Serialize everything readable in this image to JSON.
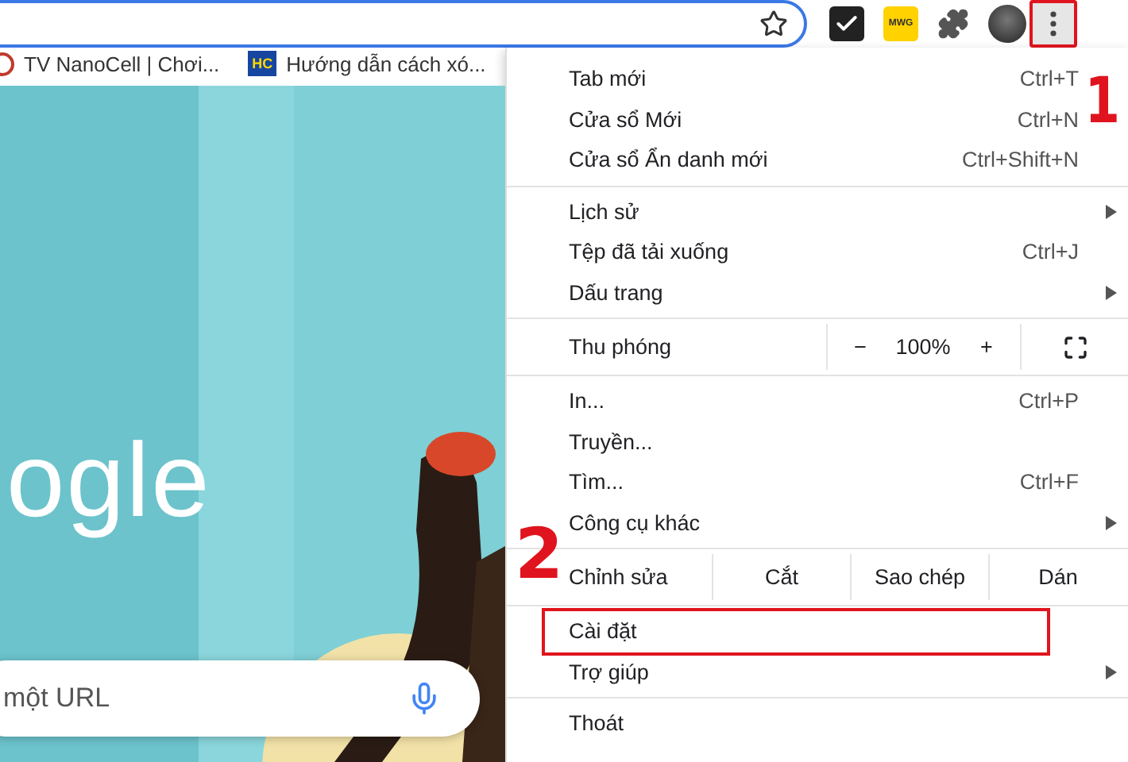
{
  "toolbar": {
    "extensions": [
      {
        "kind": "check"
      },
      {
        "kind": "badge",
        "label": "MWG"
      },
      {
        "kind": "puzzle"
      },
      {
        "kind": "avatar"
      }
    ],
    "menu_button": {
      "outlined": true
    }
  },
  "bookmarks": [
    {
      "kind": "dot",
      "title": "TV NanoCell | Chơi..."
    },
    {
      "kind": "badge",
      "badge": "HC",
      "title": "Hướng dẫn cách xó..."
    }
  ],
  "page": {
    "logo": "ogle",
    "search": {
      "placeholder": "một URL"
    }
  },
  "menu": {
    "sections": [
      [
        {
          "kind": "item",
          "label": "Tab mới",
          "shortcut": "Ctrl+T",
          "submenu": false,
          "outlined": false
        },
        {
          "kind": "item",
          "label": "Cửa sổ Mới",
          "shortcut": "Ctrl+N",
          "submenu": false,
          "outlined": false
        },
        {
          "kind": "item",
          "label": "Cửa sổ Ẩn danh mới",
          "shortcut": "Ctrl+Shift+N",
          "submenu": false,
          "outlined": false
        }
      ],
      [
        {
          "kind": "item",
          "label": "Lịch sử",
          "submenu": true,
          "outlined": false
        },
        {
          "kind": "item",
          "label": "Tệp đã tải xuống",
          "shortcut": "Ctrl+J",
          "submenu": false,
          "outlined": false
        },
        {
          "kind": "item",
          "label": "Dấu trang",
          "submenu": true,
          "outlined": false
        }
      ],
      [
        {
          "kind": "zoom",
          "label": "Thu phóng",
          "minus": "−",
          "value": "100%",
          "plus": "+"
        }
      ],
      [
        {
          "kind": "item",
          "label": "In...",
          "shortcut": "Ctrl+P",
          "submenu": false,
          "outlined": false
        },
        {
          "kind": "item",
          "label": "Truyền...",
          "submenu": false,
          "outlined": false
        },
        {
          "kind": "item",
          "label": "Tìm...",
          "shortcut": "Ctrl+F",
          "submenu": false,
          "outlined": false
        },
        {
          "kind": "item",
          "label": "Công cụ khác",
          "submenu": true,
          "outlined": false
        }
      ],
      [
        {
          "kind": "edit",
          "label": "Chỉnh sửa",
          "actions": [
            "Cắt",
            "Sao chép",
            "Dán"
          ]
        }
      ],
      [
        {
          "kind": "item",
          "label": "Cài đặt",
          "submenu": false,
          "outlined": true
        },
        {
          "kind": "item",
          "label": "Trợ giúp",
          "submenu": true,
          "outlined": false
        }
      ],
      [
        {
          "kind": "item",
          "label": "Thoát",
          "submenu": false,
          "outlined": false
        }
      ]
    ]
  },
  "annotations": [
    {
      "kind": "step-1",
      "label": "1"
    },
    {
      "kind": "step-2",
      "label": "2"
    }
  ]
}
